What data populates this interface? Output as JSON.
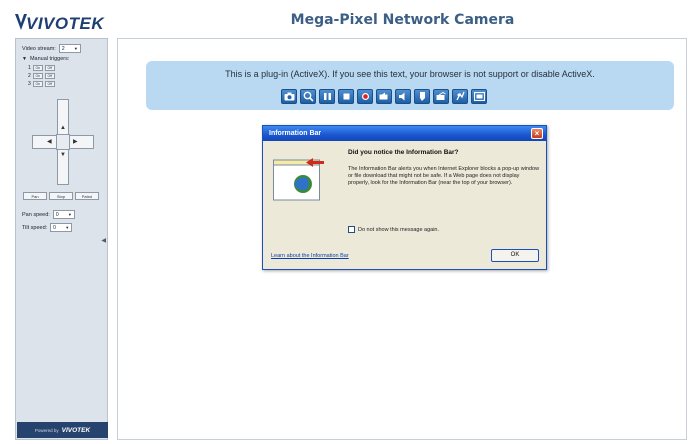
{
  "header": {
    "logo": "VIVOTEK",
    "title": "Mega-Pixel Network Camera"
  },
  "sidebar": {
    "video_stream_label": "Video stream:",
    "video_stream_value": "2",
    "manual_triggers_label": "Manual triggers:",
    "triggers": [
      {
        "number": "1",
        "on": "On",
        "off": "Off"
      },
      {
        "number": "2",
        "on": "On",
        "off": "Off"
      },
      {
        "number": "3",
        "on": "On",
        "off": "Off"
      }
    ],
    "ptz_buttons": [
      "Pan",
      "Stop",
      "Patrol"
    ],
    "pan_speed_label": "Pan speed:",
    "pan_speed_value": "0",
    "tilt_speed_label": "Tilt speed:",
    "tilt_speed_value": "0",
    "powered_by_label": "Powered by",
    "powered_by_logo": "VIVOTEK"
  },
  "plugin": {
    "message": "This is a plug-in (ActiveX). If you see this text, your browser is not support or disable ActiveX.",
    "toolbar_icons": [
      "camera-icon",
      "zoom-icon",
      "pause-icon",
      "stop-icon",
      "record-icon",
      "volume-icon",
      "speaker-icon",
      "talk-icon",
      "mic-icon",
      "digital-zoom-icon",
      "fullscreen-icon"
    ]
  },
  "dialog": {
    "title": "Information Bar",
    "heading": "Did you notice the Information Bar?",
    "body": "The Information Bar alerts you when Internet Explorer blocks a pop-up window or file download that might not be safe. If a Web page does not display properly, look for the Information Bar (near the top of your browser).",
    "checkbox_label": "Do not show this message again.",
    "link": "Learn about the Information Bar",
    "ok_label": "OK"
  }
}
